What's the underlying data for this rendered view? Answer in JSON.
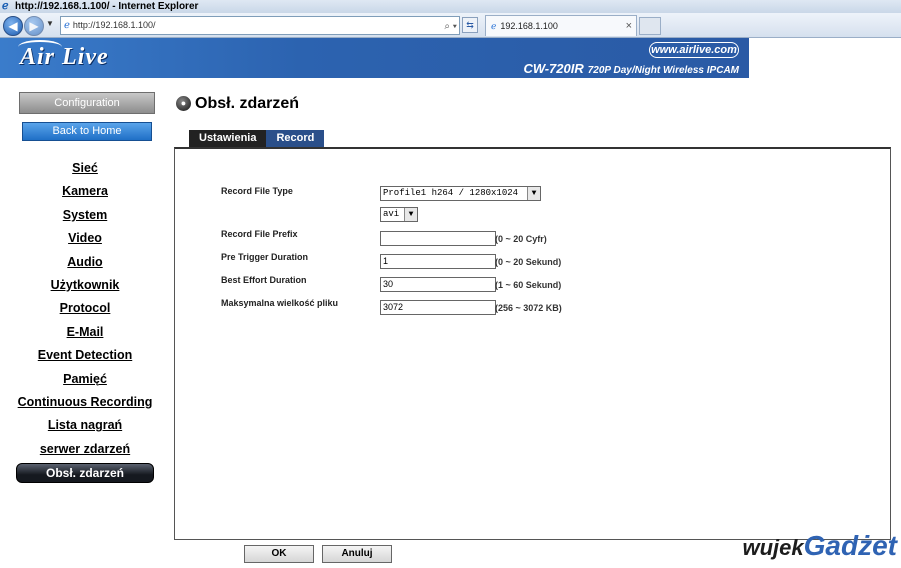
{
  "browser": {
    "window_title": "http://192.168.1.100/ - Internet Explorer",
    "address": "http://192.168.1.100/",
    "tab_title": "192.168.1.100",
    "tab_close": "×"
  },
  "banner": {
    "logo": "Air Live",
    "url": "www.airlive.com",
    "model": "CW-720IR",
    "model_desc": "720P Day/Night Wireless IPCAM"
  },
  "sidebar": {
    "configuration": "Configuration",
    "back_home": "Back to Home",
    "items": [
      {
        "label": "Sieć"
      },
      {
        "label": "Kamera"
      },
      {
        "label": "System"
      },
      {
        "label": "Video"
      },
      {
        "label": "Audio"
      },
      {
        "label": "Użytkownik"
      },
      {
        "label": "Protocol"
      },
      {
        "label": "E-Mail"
      },
      {
        "label": "Event Detection"
      },
      {
        "label": "Pamięć"
      },
      {
        "label": "Continuous Recording"
      },
      {
        "label": "Lista nagrań"
      },
      {
        "label": "serwer zdarzeń"
      },
      {
        "label": "Obsł. zdarzeń"
      }
    ]
  },
  "main": {
    "title": "Obsł. zdarzeń",
    "tabs": [
      {
        "label": "Ustawienia"
      },
      {
        "label": "Record"
      }
    ],
    "form": {
      "record_file_type_label": "Record File Type",
      "record_file_type_value": "Profile1 h264 / 1280x1024",
      "format_value": "avi",
      "prefix_label": "Record File Prefix",
      "prefix_value": "",
      "prefix_hint": "(0 ~ 20 Cyfr)",
      "pre_trigger_label": "Pre Trigger Duration",
      "pre_trigger_value": "1",
      "pre_trigger_hint": "(0 ~ 20 Sekund)",
      "best_effort_label": "Best Effort Duration",
      "best_effort_value": "30",
      "best_effort_hint": "(1 ~ 60 Sekund)",
      "max_size_label": "Maksymalna wielkość pliku",
      "max_size_value": "3072",
      "max_size_hint": "(256 ~ 3072 KB)"
    },
    "buttons": {
      "ok": "OK",
      "cancel": "Anuluj"
    }
  },
  "watermark": {
    "part1": "wujek",
    "part2": "Gadżet"
  },
  "colors": {
    "banner": "#2c63b0",
    "active_tab": "#2a4f8a",
    "nav_active": "#15191f"
  }
}
